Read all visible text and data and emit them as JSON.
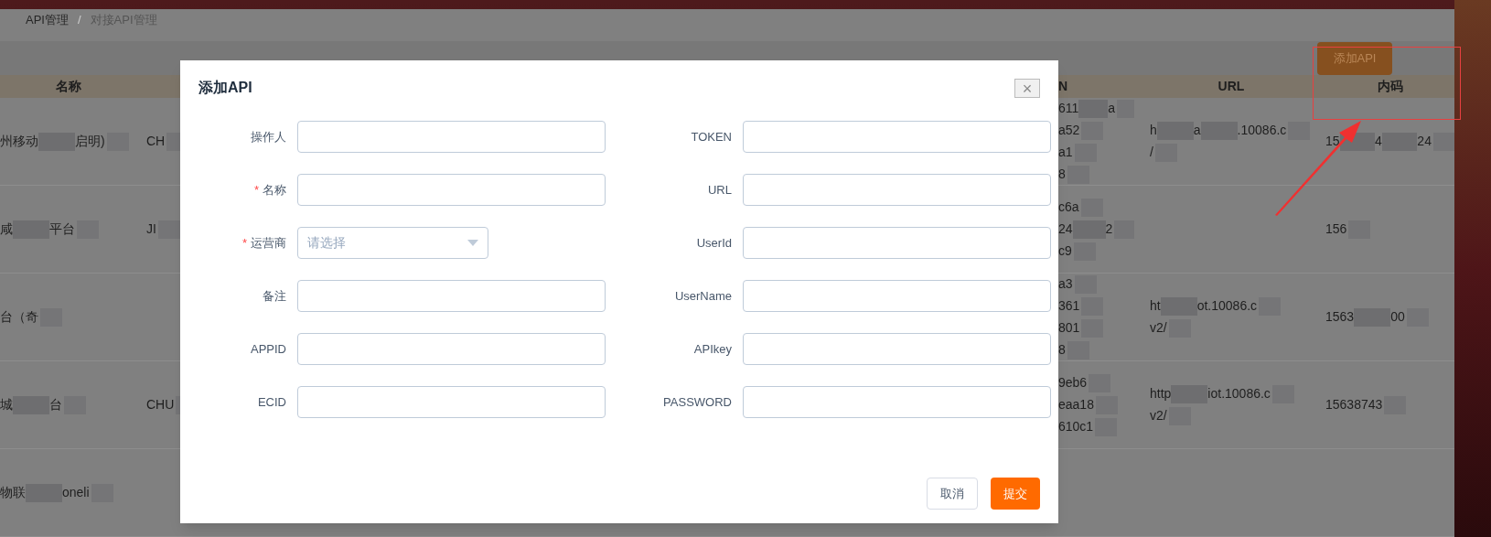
{
  "breadcrumb": [
    {
      "label": "API管理",
      "selected": false
    },
    {
      "label": "对接API管理",
      "selected": true
    }
  ],
  "breadcrumb_separator": "/",
  "toolbar": {
    "add_button": "添加API"
  },
  "table": {
    "columns": [
      "名称",
      null,
      "N",
      "URL",
      "内码"
    ],
    "rows": [
      {
        "cells": [
          [
            [
              "州移动",
              "启明)"
            ]
          ],
          [
            [
              "CH"
            ]
          ],
          [
            [
              "611",
              "a"
            ],
            [
              "a52"
            ],
            [
              "a1"
            ],
            [
              "8"
            ]
          ],
          [
            [
              "h",
              "a",
              ".10086.c"
            ],
            [
              "/"
            ]
          ],
          [
            [
              "15",
              "4",
              "24"
            ]
          ]
        ]
      },
      {
        "cells": [
          [
            [
              "咸",
              "平台"
            ]
          ],
          [
            [
              "JI"
            ]
          ],
          [
            [
              "c6a"
            ],
            [
              "24",
              "2"
            ],
            [
              "c9"
            ]
          ],
          [],
          [
            [
              "156"
            ]
          ]
        ]
      },
      {
        "cells": [
          [
            [
              "台（奇"
            ]
          ],
          [],
          [
            [
              "a3"
            ],
            [
              "361"
            ],
            [
              "801"
            ],
            [
              "8"
            ]
          ],
          [
            [
              "ht",
              "ot.10086.c"
            ],
            [
              "v2/"
            ]
          ],
          [
            [
              "1563",
              "00"
            ]
          ]
        ]
      },
      {
        "cells": [
          [
            [
              "城",
              "台"
            ]
          ],
          [
            [
              "CHU"
            ]
          ],
          [
            [
              "9eb6"
            ],
            [
              "eaa18"
            ],
            [
              "610c1"
            ]
          ],
          [
            [
              "http",
              "iot.10086.c"
            ],
            [
              "v2/"
            ]
          ],
          [
            [
              "15638743"
            ]
          ]
        ]
      },
      {
        "cells": [
          [
            [
              "物联",
              "oneli"
            ]
          ],
          [],
          [],
          [],
          []
        ]
      }
    ]
  },
  "dialog": {
    "title": "添加API",
    "close": "×",
    "left_fields": [
      {
        "label": "操作人",
        "required": false,
        "kind": "text"
      },
      {
        "label": "名称",
        "required": true,
        "kind": "text"
      },
      {
        "label": "运营商",
        "required": true,
        "kind": "select",
        "placeholder": "请选择"
      },
      {
        "label": "备注",
        "required": false,
        "kind": "text"
      },
      {
        "label": "APPID",
        "required": false,
        "kind": "text"
      },
      {
        "label": "ECID",
        "required": false,
        "kind": "text"
      }
    ],
    "right_fields": [
      {
        "label": "TOKEN",
        "required": false,
        "kind": "text"
      },
      {
        "label": "URL",
        "required": false,
        "kind": "text"
      },
      {
        "label": "UserId",
        "required": false,
        "kind": "text"
      },
      {
        "label": "UserName",
        "required": false,
        "kind": "text"
      },
      {
        "label": "APIkey",
        "required": false,
        "kind": "text"
      },
      {
        "label": "PASSWORD",
        "required": false,
        "kind": "text"
      }
    ],
    "buttons": [
      {
        "label": "取消",
        "kind": "secondary"
      },
      {
        "label": "提交",
        "kind": "primary"
      }
    ]
  },
  "required_mark": "*"
}
